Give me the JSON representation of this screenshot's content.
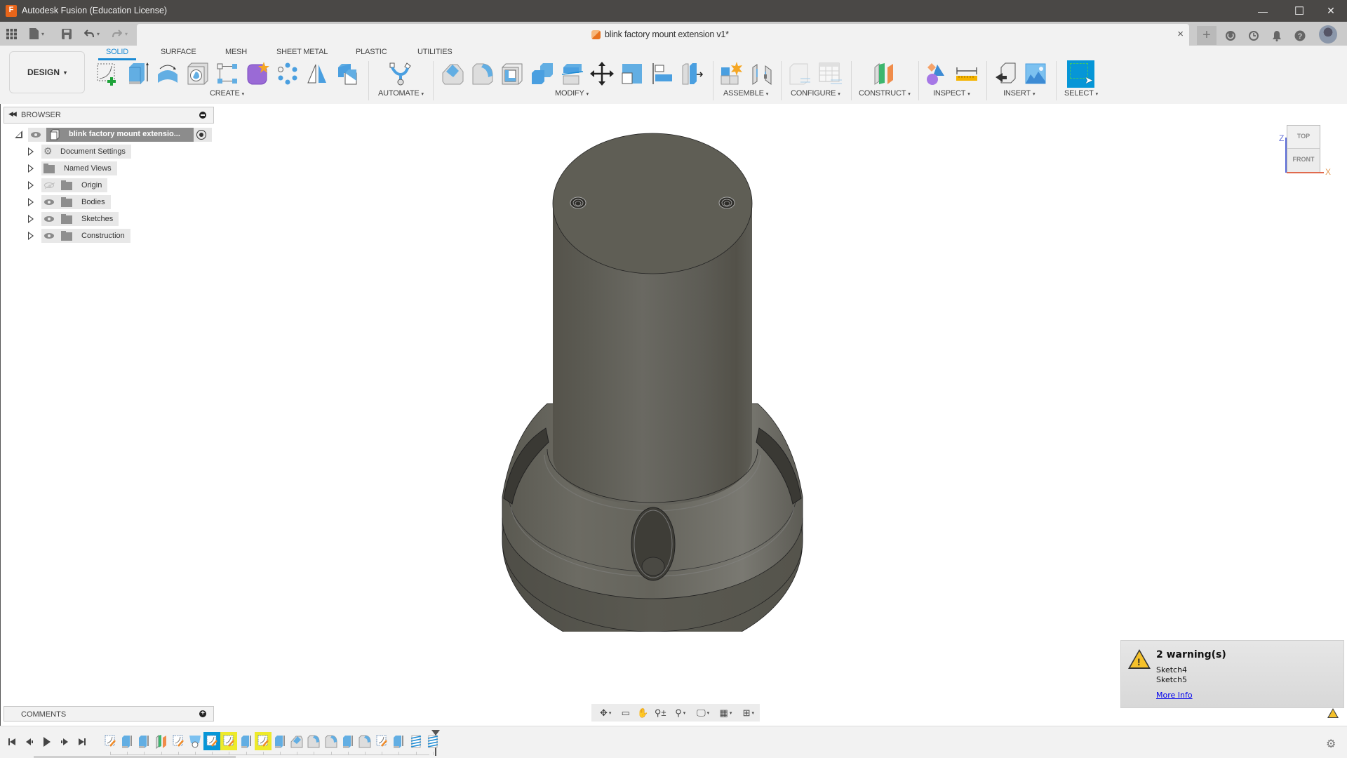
{
  "window": {
    "title": "Autodesk Fusion (Education License)",
    "app_icon_letter": "F",
    "controls": {
      "minimize": "—",
      "maximize": "☐",
      "close": "✕"
    }
  },
  "quick_access": {
    "data_panel_icon": "grid-icon",
    "file_icon": "file-icon",
    "save_icon": "save-icon",
    "undo_icon": "undo-icon",
    "redo_icon": "redo-icon",
    "caret": "▾"
  },
  "document_tab": {
    "title": "blink factory mount extension v1*",
    "close": "×"
  },
  "top_right": {
    "new_tab": "+",
    "job_status_icon": "⟳",
    "history_icon": "◷",
    "notifications_icon": "🔔",
    "help_icon": "?"
  },
  "workspace": {
    "label": "DESIGN",
    "caret": "▾"
  },
  "tabs": [
    {
      "label": "SOLID",
      "active": true
    },
    {
      "label": "SURFACE",
      "active": false
    },
    {
      "label": "MESH",
      "active": false
    },
    {
      "label": "SHEET METAL",
      "active": false
    },
    {
      "label": "PLASTIC",
      "active": false
    },
    {
      "label": "UTILITIES",
      "active": false
    }
  ],
  "toolbar_groups": [
    {
      "label": "CREATE",
      "tools": [
        "create-sketch",
        "extrude",
        "revolve",
        "hole",
        "rectangular-pattern-sketch",
        "create-form",
        "pattern",
        "mirror",
        "combine"
      ]
    },
    {
      "label": "AUTOMATE",
      "tools": [
        "automated-modeling"
      ]
    },
    {
      "label": "MODIFY",
      "tools": [
        "press-pull",
        "fillet",
        "shell",
        "combine",
        "offset-face",
        "move-copy",
        "scale",
        "align",
        "split-body"
      ]
    },
    {
      "label": "ASSEMBLE",
      "tools": [
        "new-component",
        "joint"
      ]
    },
    {
      "label": "CONFIGURE",
      "tools": [
        "configure-model",
        "configuration-table"
      ]
    },
    {
      "label": "CONSTRUCT",
      "tools": [
        "offset-plane"
      ]
    },
    {
      "label": "INSPECT",
      "tools": [
        "display-component-colors",
        "measure"
      ]
    },
    {
      "label": "INSERT",
      "tools": [
        "insert-derive",
        "decal"
      ]
    },
    {
      "label": "SELECT",
      "tools": [
        "select"
      ]
    }
  ],
  "caret": "▾",
  "browser": {
    "header": "BROWSER",
    "root": "blink factory mount extensio...",
    "items": [
      {
        "label": "Document Settings",
        "icon": "gear-icon",
        "visible": null
      },
      {
        "label": "Named Views",
        "icon": "folder-icon",
        "visible": null
      },
      {
        "label": "Origin",
        "icon": "folder-icon",
        "visible": false
      },
      {
        "label": "Bodies",
        "icon": "folder-icon",
        "visible": true
      },
      {
        "label": "Sketches",
        "icon": "folder-icon",
        "visible": true
      },
      {
        "label": "Construction",
        "icon": "folder-icon",
        "visible": true
      }
    ]
  },
  "viewcube": {
    "top": "TOP",
    "front": "FRONT",
    "axis_x": "X",
    "axis_z": "Z"
  },
  "comments": {
    "label": "COMMENTS",
    "add": "+"
  },
  "navbar": [
    {
      "name": "orbit",
      "icon": "✥",
      "has_menu": true
    },
    {
      "name": "look-at",
      "icon": "▭",
      "has_menu": false
    },
    {
      "name": "pan",
      "icon": "✋",
      "has_menu": false
    },
    {
      "name": "zoom",
      "icon": "⚲±",
      "has_menu": false
    },
    {
      "name": "fit",
      "icon": "⚲",
      "has_menu": true
    },
    {
      "name": "display-settings",
      "icon": "🖵",
      "has_menu": true
    },
    {
      "name": "grid-snaps",
      "icon": "▦",
      "has_menu": true
    },
    {
      "name": "viewports",
      "icon": "⊞",
      "has_menu": true
    }
  ],
  "warning": {
    "title": "2 warning(s)",
    "lines": [
      "Sketch4",
      "Sketch5"
    ],
    "link": "More Info",
    "exclamation": "!"
  },
  "timeline": {
    "controls": [
      "⏮",
      "◀",
      "▶",
      "▶",
      "⏭"
    ],
    "features": [
      {
        "type": "sketch",
        "state": "normal"
      },
      {
        "type": "extrude",
        "state": "normal"
      },
      {
        "type": "extrude",
        "state": "normal"
      },
      {
        "type": "plane",
        "state": "normal"
      },
      {
        "type": "sketch",
        "state": "normal"
      },
      {
        "type": "hole",
        "state": "normal"
      },
      {
        "type": "sketch",
        "state": "selected"
      },
      {
        "type": "sketch",
        "state": "warning"
      },
      {
        "type": "extrude",
        "state": "normal"
      },
      {
        "type": "sketch",
        "state": "warning"
      },
      {
        "type": "extrude",
        "state": "normal"
      },
      {
        "type": "chamfer",
        "state": "normal"
      },
      {
        "type": "fillet",
        "state": "normal"
      },
      {
        "type": "fillet",
        "state": "normal"
      },
      {
        "type": "extrude",
        "state": "normal"
      },
      {
        "type": "fillet",
        "state": "normal"
      },
      {
        "type": "sketch",
        "state": "normal"
      },
      {
        "type": "extrude",
        "state": "normal"
      },
      {
        "type": "thread",
        "state": "normal"
      },
      {
        "type": "thread",
        "state": "normal"
      }
    ],
    "settings_icon": "⚙"
  },
  "colors": {
    "accent": "#1a8ad4",
    "select_blue": "#0696d7",
    "warning_yellow": "#eeea2a",
    "model_body": "#5f5e56"
  }
}
